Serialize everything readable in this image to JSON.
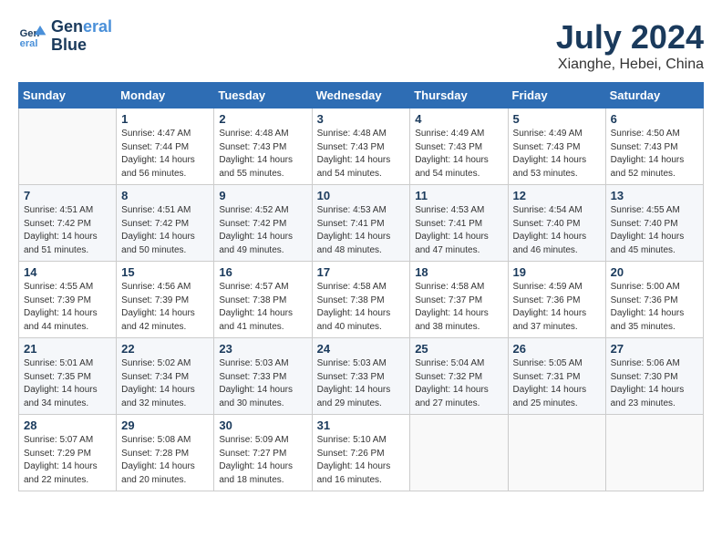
{
  "header": {
    "logo_line1": "General",
    "logo_line2": "Blue",
    "month_year": "July 2024",
    "location": "Xianghe, Hebei, China"
  },
  "weekdays": [
    "Sunday",
    "Monday",
    "Tuesday",
    "Wednesday",
    "Thursday",
    "Friday",
    "Saturday"
  ],
  "weeks": [
    [
      {
        "day": "",
        "sunrise": "",
        "sunset": "",
        "daylight": ""
      },
      {
        "day": "1",
        "sunrise": "Sunrise: 4:47 AM",
        "sunset": "Sunset: 7:44 PM",
        "daylight": "Daylight: 14 hours and 56 minutes."
      },
      {
        "day": "2",
        "sunrise": "Sunrise: 4:48 AM",
        "sunset": "Sunset: 7:43 PM",
        "daylight": "Daylight: 14 hours and 55 minutes."
      },
      {
        "day": "3",
        "sunrise": "Sunrise: 4:48 AM",
        "sunset": "Sunset: 7:43 PM",
        "daylight": "Daylight: 14 hours and 54 minutes."
      },
      {
        "day": "4",
        "sunrise": "Sunrise: 4:49 AM",
        "sunset": "Sunset: 7:43 PM",
        "daylight": "Daylight: 14 hours and 54 minutes."
      },
      {
        "day": "5",
        "sunrise": "Sunrise: 4:49 AM",
        "sunset": "Sunset: 7:43 PM",
        "daylight": "Daylight: 14 hours and 53 minutes."
      },
      {
        "day": "6",
        "sunrise": "Sunrise: 4:50 AM",
        "sunset": "Sunset: 7:43 PM",
        "daylight": "Daylight: 14 hours and 52 minutes."
      }
    ],
    [
      {
        "day": "7",
        "sunrise": "Sunrise: 4:51 AM",
        "sunset": "Sunset: 7:42 PM",
        "daylight": "Daylight: 14 hours and 51 minutes."
      },
      {
        "day": "8",
        "sunrise": "Sunrise: 4:51 AM",
        "sunset": "Sunset: 7:42 PM",
        "daylight": "Daylight: 14 hours and 50 minutes."
      },
      {
        "day": "9",
        "sunrise": "Sunrise: 4:52 AM",
        "sunset": "Sunset: 7:42 PM",
        "daylight": "Daylight: 14 hours and 49 minutes."
      },
      {
        "day": "10",
        "sunrise": "Sunrise: 4:53 AM",
        "sunset": "Sunset: 7:41 PM",
        "daylight": "Daylight: 14 hours and 48 minutes."
      },
      {
        "day": "11",
        "sunrise": "Sunrise: 4:53 AM",
        "sunset": "Sunset: 7:41 PM",
        "daylight": "Daylight: 14 hours and 47 minutes."
      },
      {
        "day": "12",
        "sunrise": "Sunrise: 4:54 AM",
        "sunset": "Sunset: 7:40 PM",
        "daylight": "Daylight: 14 hours and 46 minutes."
      },
      {
        "day": "13",
        "sunrise": "Sunrise: 4:55 AM",
        "sunset": "Sunset: 7:40 PM",
        "daylight": "Daylight: 14 hours and 45 minutes."
      }
    ],
    [
      {
        "day": "14",
        "sunrise": "Sunrise: 4:55 AM",
        "sunset": "Sunset: 7:39 PM",
        "daylight": "Daylight: 14 hours and 44 minutes."
      },
      {
        "day": "15",
        "sunrise": "Sunrise: 4:56 AM",
        "sunset": "Sunset: 7:39 PM",
        "daylight": "Daylight: 14 hours and 42 minutes."
      },
      {
        "day": "16",
        "sunrise": "Sunrise: 4:57 AM",
        "sunset": "Sunset: 7:38 PM",
        "daylight": "Daylight: 14 hours and 41 minutes."
      },
      {
        "day": "17",
        "sunrise": "Sunrise: 4:58 AM",
        "sunset": "Sunset: 7:38 PM",
        "daylight": "Daylight: 14 hours and 40 minutes."
      },
      {
        "day": "18",
        "sunrise": "Sunrise: 4:58 AM",
        "sunset": "Sunset: 7:37 PM",
        "daylight": "Daylight: 14 hours and 38 minutes."
      },
      {
        "day": "19",
        "sunrise": "Sunrise: 4:59 AM",
        "sunset": "Sunset: 7:36 PM",
        "daylight": "Daylight: 14 hours and 37 minutes."
      },
      {
        "day": "20",
        "sunrise": "Sunrise: 5:00 AM",
        "sunset": "Sunset: 7:36 PM",
        "daylight": "Daylight: 14 hours and 35 minutes."
      }
    ],
    [
      {
        "day": "21",
        "sunrise": "Sunrise: 5:01 AM",
        "sunset": "Sunset: 7:35 PM",
        "daylight": "Daylight: 14 hours and 34 minutes."
      },
      {
        "day": "22",
        "sunrise": "Sunrise: 5:02 AM",
        "sunset": "Sunset: 7:34 PM",
        "daylight": "Daylight: 14 hours and 32 minutes."
      },
      {
        "day": "23",
        "sunrise": "Sunrise: 5:03 AM",
        "sunset": "Sunset: 7:33 PM",
        "daylight": "Daylight: 14 hours and 30 minutes."
      },
      {
        "day": "24",
        "sunrise": "Sunrise: 5:03 AM",
        "sunset": "Sunset: 7:33 PM",
        "daylight": "Daylight: 14 hours and 29 minutes."
      },
      {
        "day": "25",
        "sunrise": "Sunrise: 5:04 AM",
        "sunset": "Sunset: 7:32 PM",
        "daylight": "Daylight: 14 hours and 27 minutes."
      },
      {
        "day": "26",
        "sunrise": "Sunrise: 5:05 AM",
        "sunset": "Sunset: 7:31 PM",
        "daylight": "Daylight: 14 hours and 25 minutes."
      },
      {
        "day": "27",
        "sunrise": "Sunrise: 5:06 AM",
        "sunset": "Sunset: 7:30 PM",
        "daylight": "Daylight: 14 hours and 23 minutes."
      }
    ],
    [
      {
        "day": "28",
        "sunrise": "Sunrise: 5:07 AM",
        "sunset": "Sunset: 7:29 PM",
        "daylight": "Daylight: 14 hours and 22 minutes."
      },
      {
        "day": "29",
        "sunrise": "Sunrise: 5:08 AM",
        "sunset": "Sunset: 7:28 PM",
        "daylight": "Daylight: 14 hours and 20 minutes."
      },
      {
        "day": "30",
        "sunrise": "Sunrise: 5:09 AM",
        "sunset": "Sunset: 7:27 PM",
        "daylight": "Daylight: 14 hours and 18 minutes."
      },
      {
        "day": "31",
        "sunrise": "Sunrise: 5:10 AM",
        "sunset": "Sunset: 7:26 PM",
        "daylight": "Daylight: 14 hours and 16 minutes."
      },
      {
        "day": "",
        "sunrise": "",
        "sunset": "",
        "daylight": ""
      },
      {
        "day": "",
        "sunrise": "",
        "sunset": "",
        "daylight": ""
      },
      {
        "day": "",
        "sunrise": "",
        "sunset": "",
        "daylight": ""
      }
    ]
  ]
}
